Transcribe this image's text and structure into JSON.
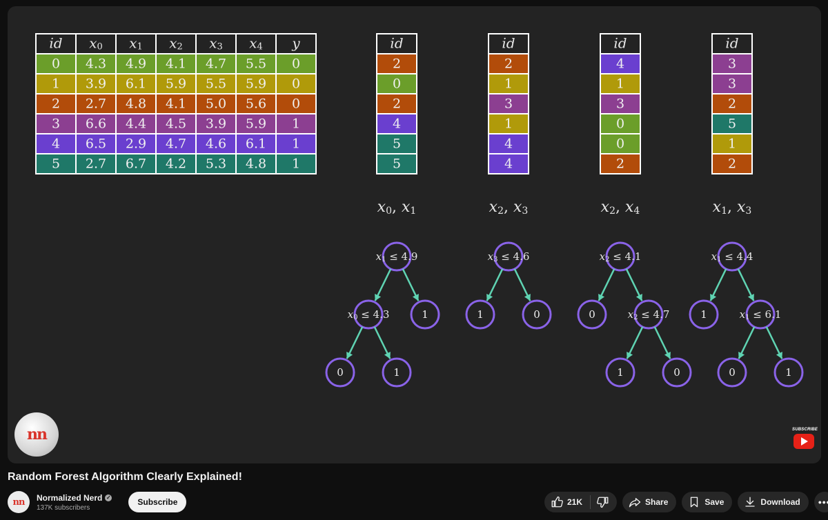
{
  "video": {
    "title": "Random Forest Algorithm Clearly Explained!"
  },
  "channel": {
    "name": "Normalized Nerd",
    "subscribers": "137K subscribers",
    "avatar_text": "nn",
    "subscribe_label": "Subscribe",
    "watermark_subscribe": "SUBSCRIBE"
  },
  "actions": {
    "likes": "21K",
    "share_label": "Share",
    "save_label": "Save",
    "download_label": "Download",
    "icons": [
      "thumbs-up-icon",
      "thumbs-down-icon",
      "share-icon",
      "bookmark-icon",
      "download-icon",
      "more-icon"
    ]
  },
  "slide": {
    "colors": {
      "green": "#6b9e2a",
      "olive": "#b09a0a",
      "orange": "#b24c0a",
      "purple": "#8c3f91",
      "violet": "#6a3fcf",
      "teal": "#1f7868",
      "node_ring": "#8a63e8",
      "edge": "#5fd3b2"
    },
    "dataset": {
      "headers": [
        "id",
        "x0",
        "x1",
        "x2",
        "x3",
        "x4",
        "y"
      ],
      "rows": [
        {
          "color": "green",
          "cells": [
            "0",
            "4.3",
            "4.9",
            "4.1",
            "4.7",
            "5.5",
            "0"
          ]
        },
        {
          "color": "olive",
          "cells": [
            "1",
            "3.9",
            "6.1",
            "5.9",
            "5.5",
            "5.9",
            "0"
          ]
        },
        {
          "color": "orange",
          "cells": [
            "2",
            "2.7",
            "4.8",
            "4.1",
            "5.0",
            "5.6",
            "0"
          ]
        },
        {
          "color": "purple",
          "cells": [
            "3",
            "6.6",
            "4.4",
            "4.5",
            "3.9",
            "5.9",
            "1"
          ]
        },
        {
          "color": "violet",
          "cells": [
            "4",
            "6.5",
            "2.9",
            "4.7",
            "4.6",
            "6.1",
            "1"
          ]
        },
        {
          "color": "teal",
          "cells": [
            "5",
            "2.7",
            "6.7",
            "4.2",
            "5.3",
            "4.8",
            "1"
          ]
        }
      ]
    },
    "bootstraps": [
      {
        "header": "id",
        "rows": [
          {
            "id": "2",
            "color": "orange"
          },
          {
            "id": "0",
            "color": "green"
          },
          {
            "id": "2",
            "color": "orange"
          },
          {
            "id": "4",
            "color": "violet"
          },
          {
            "id": "5",
            "color": "teal"
          },
          {
            "id": "5",
            "color": "teal"
          }
        ],
        "features": [
          {
            "sub": "0"
          },
          {
            "sub": "1"
          }
        ],
        "tree": {
          "label": {
            "sub": "1",
            "rest": " ≤ 4.9"
          },
          "left": {
            "label": {
              "sub": "0",
              "rest": " ≤ 4.3"
            },
            "left": {
              "leaf": "0"
            },
            "right": {
              "leaf": "1"
            }
          },
          "right": {
            "leaf": "1"
          }
        }
      },
      {
        "header": "id",
        "rows": [
          {
            "id": "2",
            "color": "orange"
          },
          {
            "id": "1",
            "color": "olive"
          },
          {
            "id": "3",
            "color": "purple"
          },
          {
            "id": "1",
            "color": "olive"
          },
          {
            "id": "4",
            "color": "violet"
          },
          {
            "id": "4",
            "color": "violet"
          }
        ],
        "features": [
          {
            "sub": "2"
          },
          {
            "sub": "3"
          }
        ],
        "tree": {
          "label": {
            "sub": "3",
            "rest": " ≤ 4.6"
          },
          "left": {
            "leaf": "1"
          },
          "right": {
            "leaf": "0"
          }
        }
      },
      {
        "header": "id",
        "rows": [
          {
            "id": "4",
            "color": "violet"
          },
          {
            "id": "1",
            "color": "olive"
          },
          {
            "id": "3",
            "color": "purple"
          },
          {
            "id": "0",
            "color": "green"
          },
          {
            "id": "0",
            "color": "green"
          },
          {
            "id": "2",
            "color": "orange"
          }
        ],
        "features": [
          {
            "sub": "2"
          },
          {
            "sub": "4"
          }
        ],
        "tree": {
          "label": {
            "sub": "2",
            "rest": " ≤ 4.1"
          },
          "left": {
            "leaf": "0"
          },
          "right": {
            "label": {
              "sub": "2",
              "rest": " ≤ 4.7"
            },
            "left": {
              "leaf": "1"
            },
            "right": {
              "leaf": "0"
            }
          }
        }
      },
      {
        "header": "id",
        "rows": [
          {
            "id": "3",
            "color": "purple"
          },
          {
            "id": "3",
            "color": "purple"
          },
          {
            "id": "2",
            "color": "orange"
          },
          {
            "id": "5",
            "color": "teal"
          },
          {
            "id": "1",
            "color": "olive"
          },
          {
            "id": "2",
            "color": "orange"
          }
        ],
        "features": [
          {
            "sub": "1"
          },
          {
            "sub": "3"
          }
        ],
        "tree": {
          "label": {
            "sub": "1",
            "rest": " ≤ 4.4"
          },
          "left": {
            "leaf": "1"
          },
          "right": {
            "label": {
              "sub": "1",
              "rest": " ≤ 6.1"
            },
            "left": {
              "leaf": "0"
            },
            "right": {
              "leaf": "1"
            }
          }
        }
      }
    ]
  }
}
